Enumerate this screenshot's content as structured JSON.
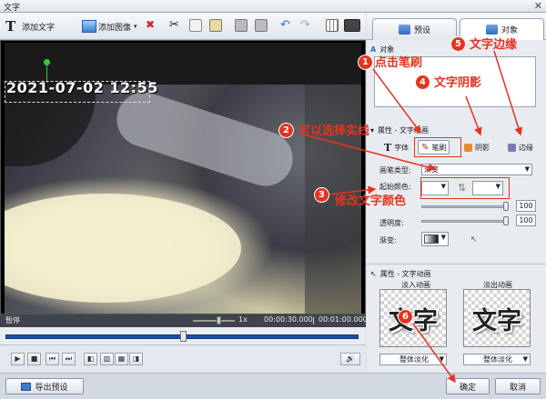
{
  "window": {
    "title": "文字"
  },
  "toolbar": {
    "add_text": "添加文字",
    "add_image": "添加图像"
  },
  "tabs": [
    {
      "label": "预设",
      "icon": "preset-icon"
    },
    {
      "label": "对象",
      "icon": "object-icon"
    }
  ],
  "video": {
    "timestamp": "2021-07-02 12:55",
    "status": "暂停",
    "speed": "1x",
    "time_current": "00:00:30.000",
    "time_total": "00:01:00.000"
  },
  "bottom": {
    "export_preset": "导出预设",
    "ok": "确定",
    "cancel": "取消"
  },
  "panel": {
    "object_section": "对象",
    "text_style_section": "属性 - 文字绘画",
    "subtabs": [
      "字体",
      "笔刷",
      "阴影",
      "边缘"
    ],
    "brush_type_label": "画笔类型:",
    "brush_type_value": "渐变",
    "start_color_label": "起始颜色:",
    "opacity_value_1": "100",
    "transparency_label": "透明度:",
    "opacity_value_2": "100",
    "gradient_label": "渐变:",
    "anim_section": "属性 - 文字动画",
    "fade_in_label": "淡入动画",
    "fade_out_label": "淡出动画",
    "preview_text": "文字",
    "fade_in_value": "整体淡化",
    "fade_out_value": "整体淡化"
  },
  "annotations": [
    {
      "num": "1",
      "text": "点击笔刷"
    },
    {
      "num": "2",
      "text": "可以选择实线"
    },
    {
      "num": "3",
      "text": "修改文字颜色"
    },
    {
      "num": "4",
      "text": "文字阴影"
    },
    {
      "num": "5",
      "text": "文字边缘"
    },
    {
      "num": "6",
      "text": ""
    }
  ],
  "colors": {
    "annotation_red": "#e5331f",
    "timeline_blue": "#1c4fa8"
  }
}
